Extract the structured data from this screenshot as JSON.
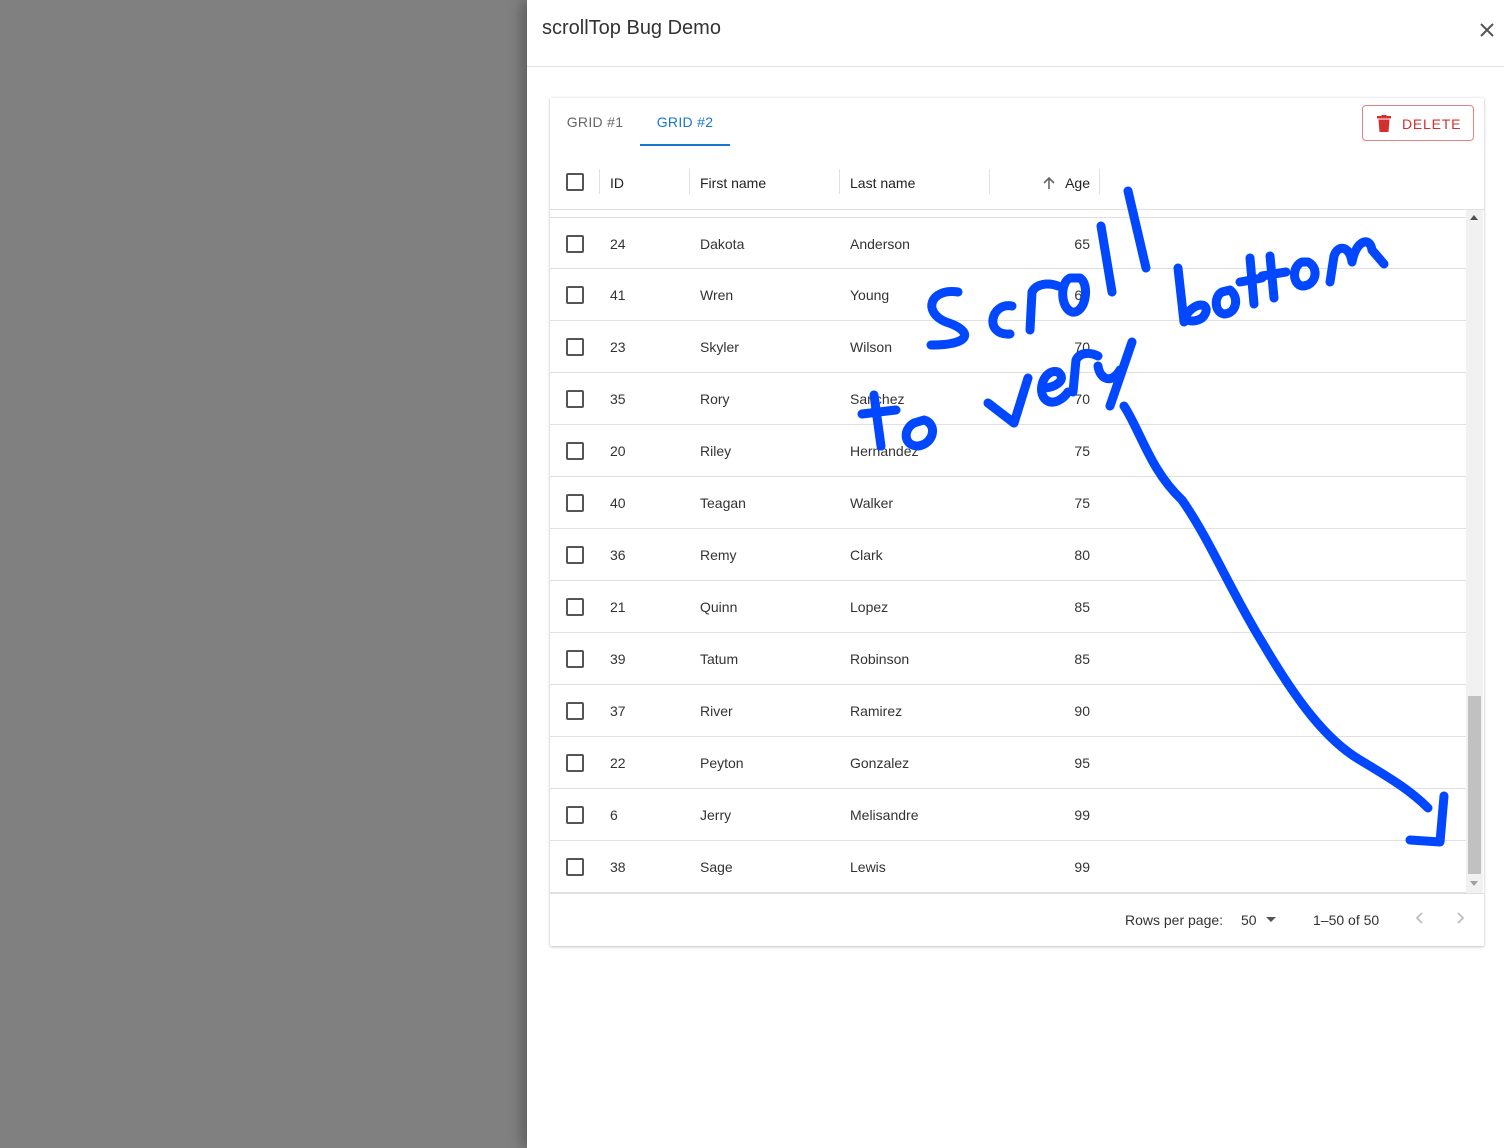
{
  "drawer": {
    "title": "scrollTop Bug Demo"
  },
  "tabs": [
    {
      "label": "GRID #1",
      "active": false
    },
    {
      "label": "GRID #2",
      "active": true
    }
  ],
  "toolbar": {
    "delete_label": "DELETE"
  },
  "columns": {
    "id": "ID",
    "first_name": "First name",
    "last_name": "Last name",
    "age": "Age",
    "age_sort": "ascending"
  },
  "rows": [
    {
      "id": "24",
      "first_name": "Dakota",
      "last_name": "Anderson",
      "age": "65"
    },
    {
      "id": "41",
      "first_name": "Wren",
      "last_name": "Young",
      "age": "65"
    },
    {
      "id": "23",
      "first_name": "Skyler",
      "last_name": "Wilson",
      "age": "70"
    },
    {
      "id": "35",
      "first_name": "Rory",
      "last_name": "Sanchez",
      "age": "70"
    },
    {
      "id": "20",
      "first_name": "Riley",
      "last_name": "Hernandez",
      "age": "75"
    },
    {
      "id": "40",
      "first_name": "Teagan",
      "last_name": "Walker",
      "age": "75"
    },
    {
      "id": "36",
      "first_name": "Remy",
      "last_name": "Clark",
      "age": "80"
    },
    {
      "id": "21",
      "first_name": "Quinn",
      "last_name": "Lopez",
      "age": "85"
    },
    {
      "id": "39",
      "first_name": "Tatum",
      "last_name": "Robinson",
      "age": "85"
    },
    {
      "id": "37",
      "first_name": "River",
      "last_name": "Ramirez",
      "age": "90"
    },
    {
      "id": "22",
      "first_name": "Peyton",
      "last_name": "Gonzalez",
      "age": "95"
    },
    {
      "id": "6",
      "first_name": "Jerry",
      "last_name": "Melisandre",
      "age": "99"
    },
    {
      "id": "38",
      "first_name": "Sage",
      "last_name": "Lewis",
      "age": "99"
    }
  ],
  "pagination": {
    "rows_per_page_label": "Rows per page:",
    "rows_per_page": "50",
    "range": "1–50 of 50"
  },
  "annotation": {
    "text": "Scroll to very bottom",
    "color": "#0047ff"
  },
  "colors": {
    "accent": "#1976d2",
    "danger": "#d32f2f",
    "backdrop": "#808080"
  }
}
